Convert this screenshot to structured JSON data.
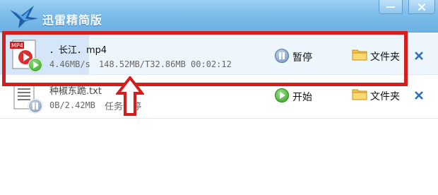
{
  "app": {
    "title": "迅雷精简版"
  },
  "window": {
    "minimize_icon": "minimize-icon",
    "close_icon": "close-icon"
  },
  "tasks": [
    {
      "name": "．长江．mp4",
      "icon_label": "MP4",
      "speed": "4.46MB/s",
      "progress": "148.52MB/T32.86MB 00:02:12",
      "action_label": "暂停",
      "folder_label": "文件夹",
      "badge": "play"
    },
    {
      "name": "种椒东跪.txt",
      "size": "0B/2.42MB",
      "status": "任务暂停",
      "action_label": "开始",
      "folder_label": "文件夹",
      "badge": "pause"
    }
  ],
  "colors": {
    "accent": "#6bb1e4",
    "highlight": "#d51d1d",
    "delete": "#2a6fb8"
  }
}
